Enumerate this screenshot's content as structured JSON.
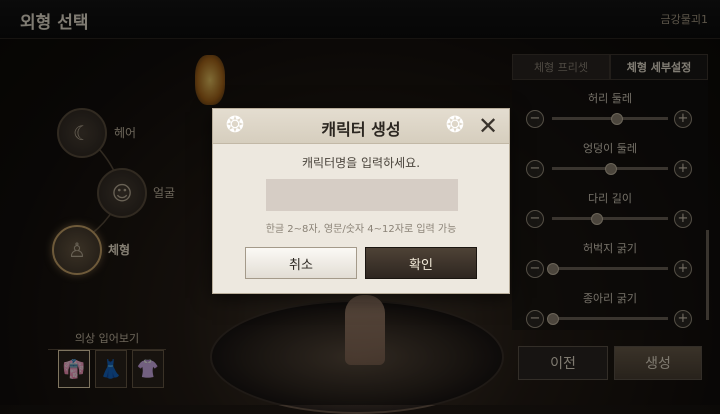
{
  "header": {
    "title": "외형 선택",
    "character_name": "금강물괴1"
  },
  "categories": [
    {
      "label": "헤어",
      "icon": "hair-icon"
    },
    {
      "label": "얼굴",
      "icon": "face-icon"
    },
    {
      "label": "체형",
      "icon": "body-icon",
      "active": true
    }
  ],
  "outfit_preview": {
    "label": "의상 입어보기",
    "items": [
      "outfit-1",
      "outfit-2",
      "outfit-3"
    ],
    "selected": 0
  },
  "right_panel": {
    "tabs": [
      {
        "label": "체형 프리셋"
      },
      {
        "label": "체형 세부설정",
        "active": true
      }
    ],
    "sliders": [
      {
        "label": "허리 둘레",
        "value": 0.55
      },
      {
        "label": "엉덩이 둘레",
        "value": 0.5
      },
      {
        "label": "다리 길이",
        "value": 0.38
      },
      {
        "label": "허벅지 굵기",
        "value": 0.0
      },
      {
        "label": "종아리 굵기",
        "value": 0.0
      }
    ],
    "prev_label": "이전",
    "create_label": "생성"
  },
  "modal": {
    "title": "캐릭터 생성",
    "prompt": "캐릭터명을 입력하세요.",
    "input_value": "",
    "hint": "한글 2~8자, 영문/숫자 4~12자로 입력 가능",
    "cancel_label": "취소",
    "confirm_label": "확인"
  }
}
